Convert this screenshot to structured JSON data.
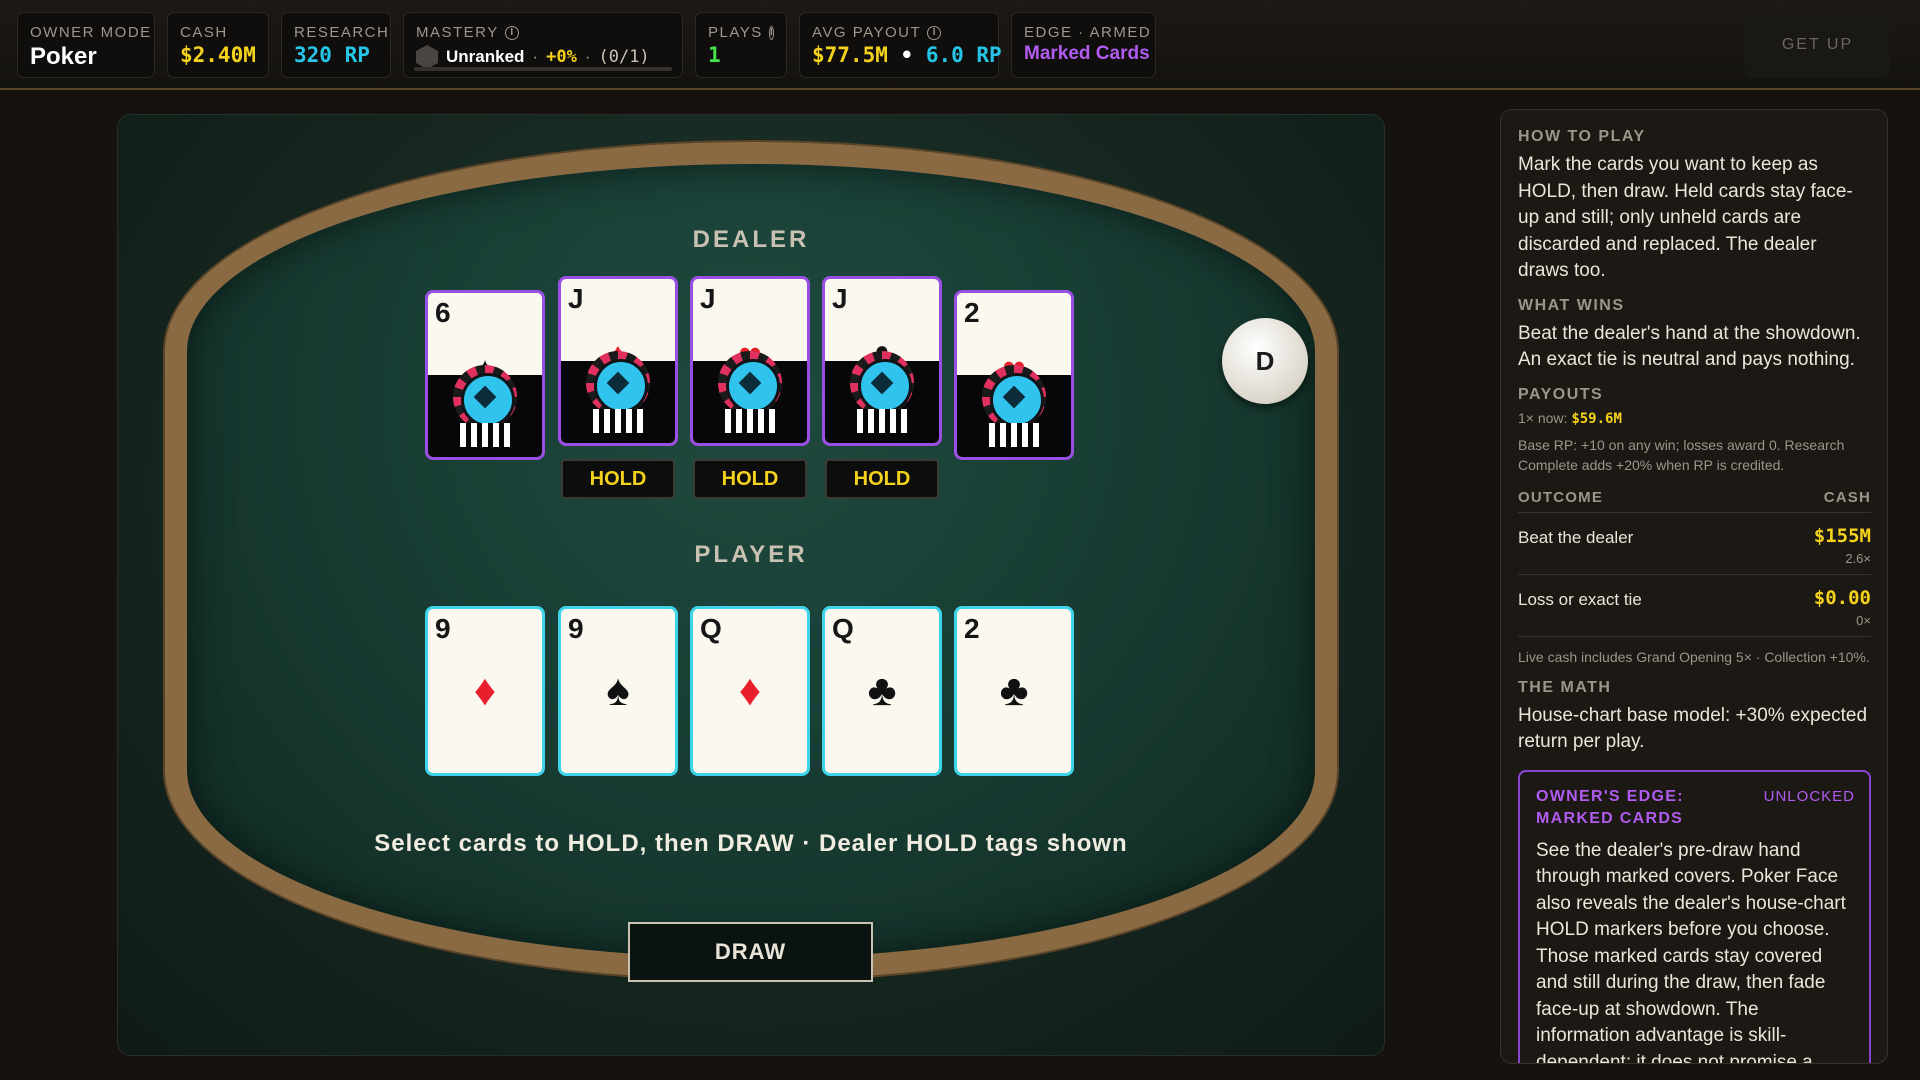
{
  "topbar": {
    "owner_mode": {
      "label": "OWNER MODE",
      "value": "Poker"
    },
    "cash": {
      "label": "CASH",
      "value": "$2.40M"
    },
    "research": {
      "label": "RESEARCH",
      "value": "320 RP"
    },
    "mastery": {
      "label": "MASTERY",
      "rank": "Unranked",
      "dot1": "·",
      "bonus": "+0%",
      "dot2": "·",
      "progress": "(0/1)",
      "progress_fraction": 0
    },
    "plays": {
      "label": "PLAYS",
      "value": "1"
    },
    "avg_payout": {
      "label": "AVG PAYOUT",
      "cash": "$77.5M",
      "sep": "•",
      "rp": "6.0 RP"
    },
    "edge": {
      "label": "EDGE · ARMED",
      "value": "Marked Cards"
    },
    "get_up": "GET UP"
  },
  "table": {
    "dealer_label": "DEALER",
    "player_label": "PLAYER",
    "dealer_button": "D",
    "dealer_cards": [
      {
        "rank": "6",
        "suit": "♠",
        "color": "black",
        "held": false
      },
      {
        "rank": "J",
        "suit": "♦",
        "color": "red",
        "held": true
      },
      {
        "rank": "J",
        "suit": "♥",
        "color": "red",
        "held": true
      },
      {
        "rank": "J",
        "suit": "♣",
        "color": "black",
        "held": true
      },
      {
        "rank": "2",
        "suit": "♥",
        "color": "red",
        "held": false
      }
    ],
    "hold_label": "HOLD",
    "player_cards": [
      {
        "rank": "9",
        "suit": "♦",
        "color": "red"
      },
      {
        "rank": "9",
        "suit": "♠",
        "color": "black"
      },
      {
        "rank": "Q",
        "suit": "♦",
        "color": "red"
      },
      {
        "rank": "Q",
        "suit": "♣",
        "color": "black"
      },
      {
        "rank": "2",
        "suit": "♣",
        "color": "black"
      }
    ],
    "instruction": "Select cards to HOLD, then DRAW · Dealer HOLD tags shown",
    "draw_button": "DRAW"
  },
  "side": {
    "how_head": "HOW TO PLAY",
    "how_text": "Mark the cards you want to keep as HOLD, then draw. Held cards stay face-up and still; only unheld cards are discarded and replaced. The dealer draws too.",
    "wins_head": "WHAT WINS",
    "wins_text": "Beat the dealer's hand at the showdown. An exact tie is neutral and pays nothing.",
    "payouts_head": "PAYOUTS",
    "payout_now_label": "1× now:",
    "payout_now_value": "$59.6M",
    "base_rp_note": "Base RP: +10 on any win; losses award 0. Research Complete adds +20% when RP is credited.",
    "col_outcome": "OUTCOME",
    "col_cash": "CASH",
    "rows": [
      {
        "outcome": "Beat the dealer",
        "cash": "$155M",
        "mult": "2.6×"
      },
      {
        "outcome": "Loss or exact tie",
        "cash": "$0.00",
        "mult": "0×"
      }
    ],
    "live_note": "Live cash includes Grand Opening 5× · Collection +10%.",
    "math_head": "THE MATH",
    "math_text": "House-chart base model: +30% expected return per play.",
    "edge_title": "OWNER'S EDGE: MARKED CARDS",
    "edge_badge": "UNLOCKED",
    "edge_text": "See the dealer's pre-draw hand through marked covers. Poker Face also reveals the dealer's house-chart HOLD markers before you choose. Those marked cards stay covered and still during the draw, then fade face-up at showdown. The information advantage is skill-dependent; it does not promise a numeric return lift."
  }
}
